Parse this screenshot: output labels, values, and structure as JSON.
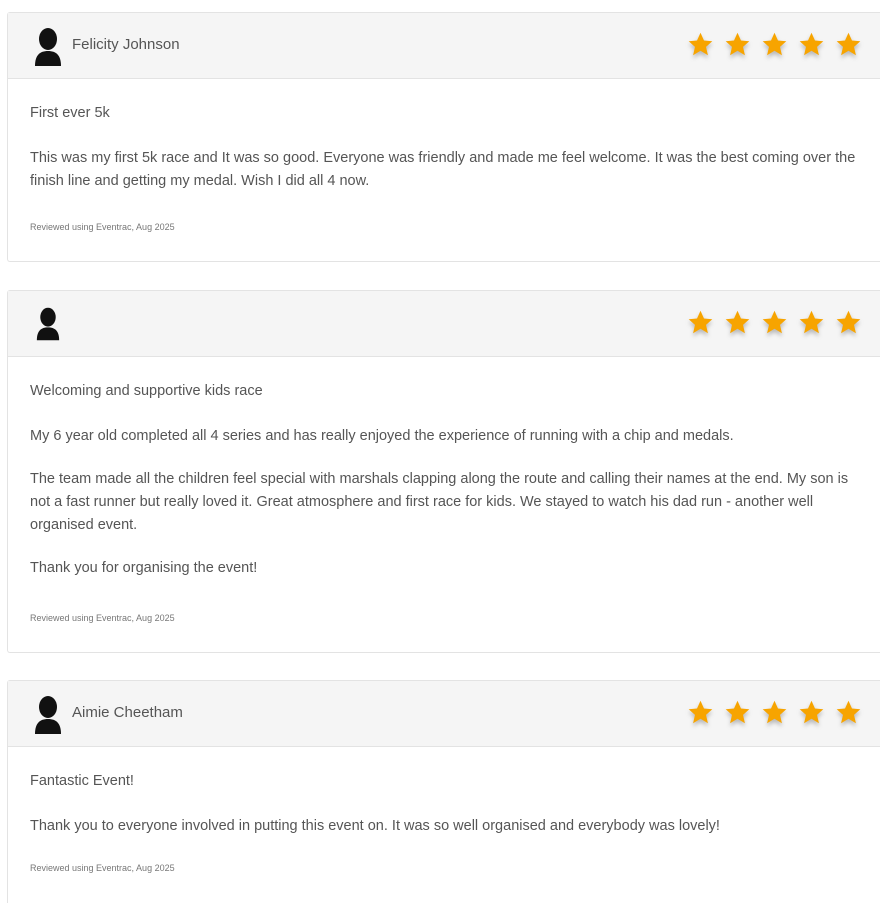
{
  "colors": {
    "star": "#F7A400",
    "header_bg": "#F5F5F5",
    "border": "#E3E3E3",
    "text": "#555555"
  },
  "reviews": [
    {
      "reviewer": "Felicity Johnson",
      "rating": 5,
      "title": "First ever 5k",
      "paragraphs": [
        "This was my first 5k race and It was so good. Everyone was friendly and made me feel welcome. It was the best coming over the finish line and getting my medal. Wish I did all 4 now."
      ],
      "meta": "Reviewed using Eventrac, Aug 2025"
    },
    {
      "reviewer": "",
      "rating": 5,
      "title": "Welcoming and supportive kids race",
      "paragraphs": [
        "My 6 year old completed all 4 series and has really enjoyed the experience of running with a chip and medals.",
        "The team made all the children feel special with marshals clapping along the route and calling their names at the end. My son is not a fast runner but really loved it. Great atmosphere and first race for kids. We stayed to watch his dad run - another well organised event.",
        "Thank you for organising the event!"
      ],
      "meta": "Reviewed using Eventrac, Aug 2025"
    },
    {
      "reviewer": "Aimie Cheetham",
      "rating": 5,
      "title": "Fantastic Event!",
      "paragraphs": [
        "Thank you to everyone involved in putting this event on. It was so well organised and everybody was lovely!"
      ],
      "meta": "Reviewed using Eventrac, Aug 2025"
    }
  ]
}
